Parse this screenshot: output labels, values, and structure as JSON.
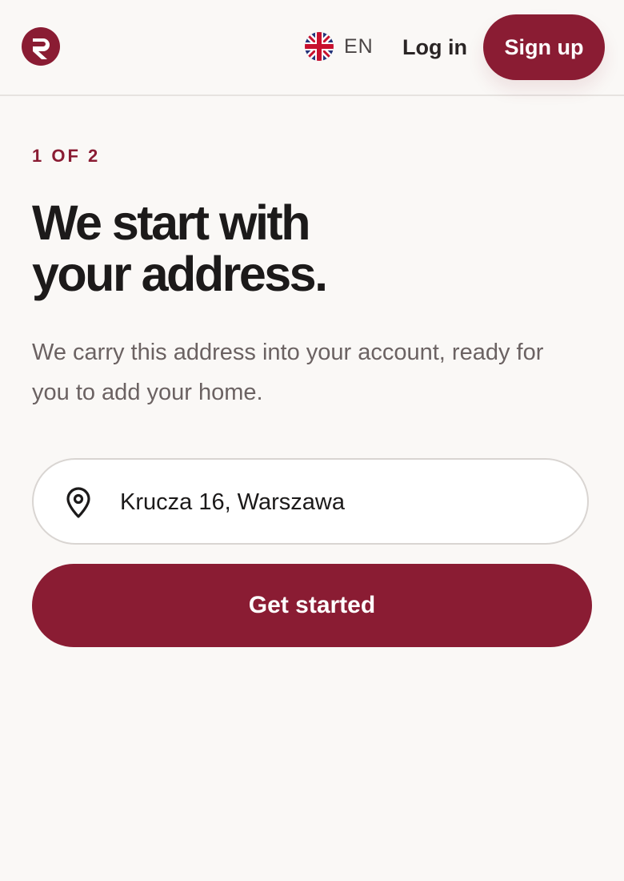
{
  "brand": {
    "logo_icon": "brand-logo-r",
    "accent_color": "#8a1c33"
  },
  "header": {
    "language": {
      "flag_icon": "uk-flag-icon",
      "label": "EN"
    },
    "login_label": "Log in",
    "signup_label": "Sign up"
  },
  "main": {
    "step": "1 OF 2",
    "title": "We start with your address.",
    "description": "We carry this address into your account, ready for you to add your home.",
    "address_input": {
      "icon": "location-pin-icon",
      "value": "Krucza 16, Warszawa",
      "placeholder": ""
    },
    "cta_label": "Get started"
  }
}
